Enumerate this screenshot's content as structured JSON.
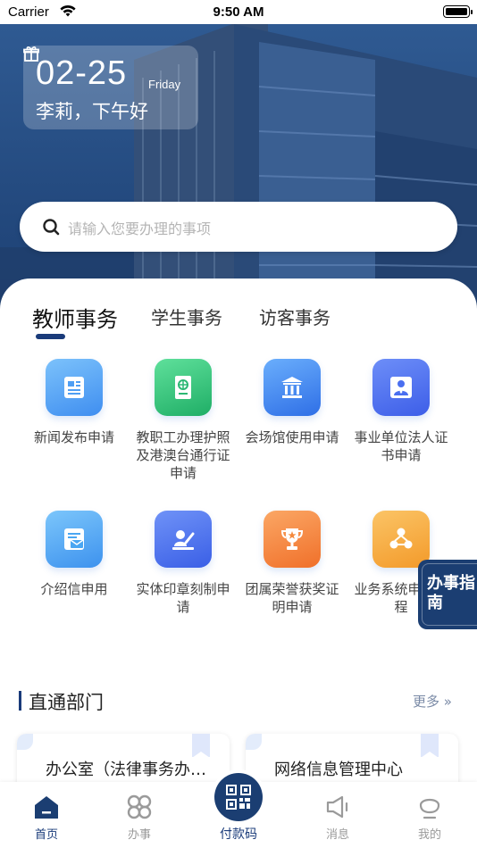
{
  "status_bar": {
    "carrier": "Carrier",
    "time": "9:50 AM"
  },
  "header": {
    "date": "02-25",
    "weekday": "Friday",
    "greeting": "李莉，下午好"
  },
  "search": {
    "placeholder": "请输入您要办理的事项"
  },
  "tabs": [
    {
      "label": "教师事务",
      "active": true
    },
    {
      "label": "学生事务",
      "active": false
    },
    {
      "label": "访客事务",
      "active": false
    }
  ],
  "services": [
    {
      "label": "新闻发布申请",
      "icon": "newspaper-icon",
      "color": "#5aa8f5"
    },
    {
      "label": "教职工办理护照及港澳台通行证申请",
      "icon": "passport-icon",
      "color": "#33c27a"
    },
    {
      "label": "会场馆使用申请",
      "icon": "venue-icon",
      "color": "#3d86f0"
    },
    {
      "label": "事业单位法人证书申请",
      "icon": "legal-person-icon",
      "color": "#4a6ff0"
    },
    {
      "label": "介绍信申用",
      "icon": "letter-icon",
      "color": "#4aa6f2"
    },
    {
      "label": "实体印章刻制申请",
      "icon": "seal-icon",
      "color": "#4b74ee"
    },
    {
      "label": "团属荣誉获奖证明申请",
      "icon": "trophy-icon",
      "color": "#f58a3c"
    },
    {
      "label": "业务系统申请流程",
      "icon": "workflow-icon",
      "color": "#f5a93c"
    }
  ],
  "guide_badge": {
    "label": "办事指南"
  },
  "departments": {
    "title": "直通部门",
    "more": "更多",
    "items": [
      {
        "name": "办公室（法律事务办公室）"
      },
      {
        "name": "网络信息管理中心"
      }
    ]
  },
  "tabbar": {
    "items": [
      {
        "label": "首页",
        "icon": "home-icon",
        "active": true
      },
      {
        "label": "办事",
        "icon": "services-icon",
        "active": false
      },
      {
        "label": "付款码",
        "icon": "qr-code-icon",
        "active": false
      },
      {
        "label": "消息",
        "icon": "speaker-icon",
        "active": false
      },
      {
        "label": "我的",
        "icon": "profile-icon",
        "active": false
      }
    ]
  },
  "colors": {
    "brand": "#1a3b7a",
    "hero": "#24508a"
  }
}
